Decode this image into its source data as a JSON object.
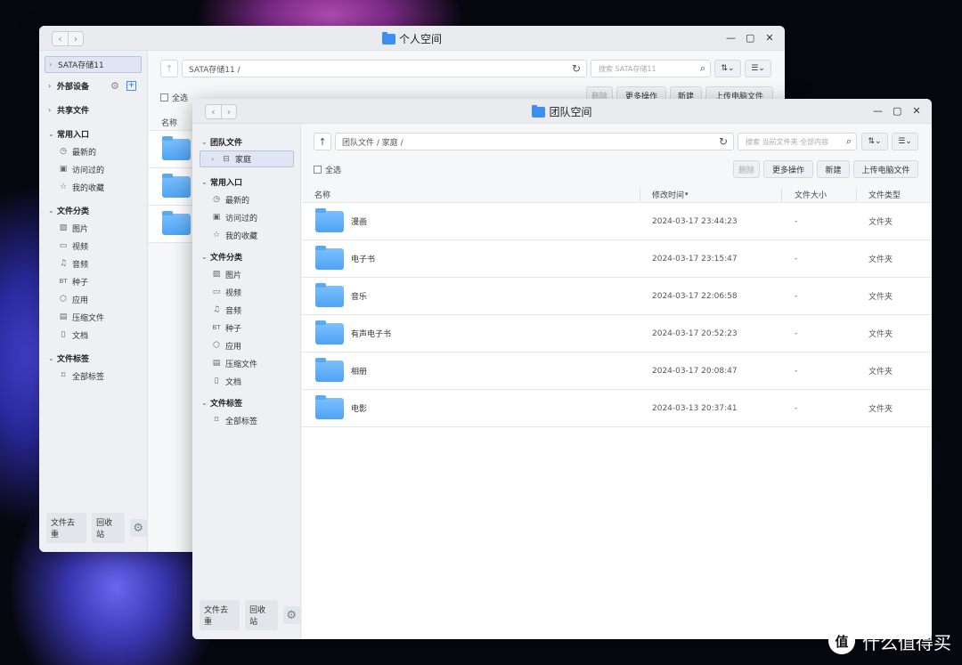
{
  "back_window": {
    "title": "个人空间",
    "sidebar": {
      "top_item": "SATA存储11",
      "ext_devices": "外部设备",
      "shared": "共享文件",
      "common_group": "常用入口",
      "common_items": [
        "最新的",
        "访问过的",
        "我的收藏"
      ],
      "category_group": "文件分类",
      "category_items": [
        "图片",
        "视频",
        "音频",
        "种子",
        "应用",
        "压缩文件",
        "文档"
      ],
      "tags_group": "文件标签",
      "tags_item": "全部标签",
      "dedupe": "文件去重",
      "recycle": "回收站"
    },
    "path": "SATA存储11 /",
    "search_placeholder": "搜索 SATA存储11",
    "select_all": "全选",
    "delete": "删除",
    "more_ops": "更多操作",
    "new": "新建",
    "upload": "上传电脑文件",
    "col_name": "名称"
  },
  "front_window": {
    "title": "团队空间",
    "sidebar": {
      "team_group": "团队文件",
      "team_item": "家庭",
      "common_group": "常用入口",
      "common_items": [
        "最新的",
        "访问过的",
        "我的收藏"
      ],
      "category_group": "文件分类",
      "category_items": [
        "图片",
        "视频",
        "音频",
        "种子",
        "应用",
        "压缩文件",
        "文档"
      ],
      "tags_group": "文件标签",
      "tags_item": "全部标签",
      "dedupe": "文件去重",
      "recycle": "回收站"
    },
    "path": "团队文件 / 家庭 /",
    "search_placeholder": "搜索 当前文件夹 全部内容",
    "select_all": "全选",
    "delete": "删除",
    "more_ops": "更多操作",
    "new": "新建",
    "upload": "上传电脑文件",
    "columns": {
      "name": "名称",
      "modified": "修改时间",
      "size": "文件大小",
      "type": "文件类型"
    },
    "rows": [
      {
        "name": "漫画",
        "modified": "2024-03-17 23:44:23",
        "size": "-",
        "type": "文件夹"
      },
      {
        "name": "电子书",
        "modified": "2024-03-17 23:15:47",
        "size": "-",
        "type": "文件夹"
      },
      {
        "name": "音乐",
        "modified": "2024-03-17 22:06:58",
        "size": "-",
        "type": "文件夹"
      },
      {
        "name": "有声电子书",
        "modified": "2024-03-17 20:52:23",
        "size": "-",
        "type": "文件夹"
      },
      {
        "name": "相册",
        "modified": "2024-03-17 20:08:47",
        "size": "-",
        "type": "文件夹"
      },
      {
        "name": "电影",
        "modified": "2024-03-13 20:37:41",
        "size": "-",
        "type": "文件夹"
      }
    ]
  },
  "watermark": {
    "badge": "值",
    "text": "什么值得买"
  },
  "icons": {
    "accent": "#3d8df5",
    "folder": "folder-icon",
    "refresh": "refresh-icon",
    "search": "search-icon",
    "gear": "gear-icon"
  }
}
